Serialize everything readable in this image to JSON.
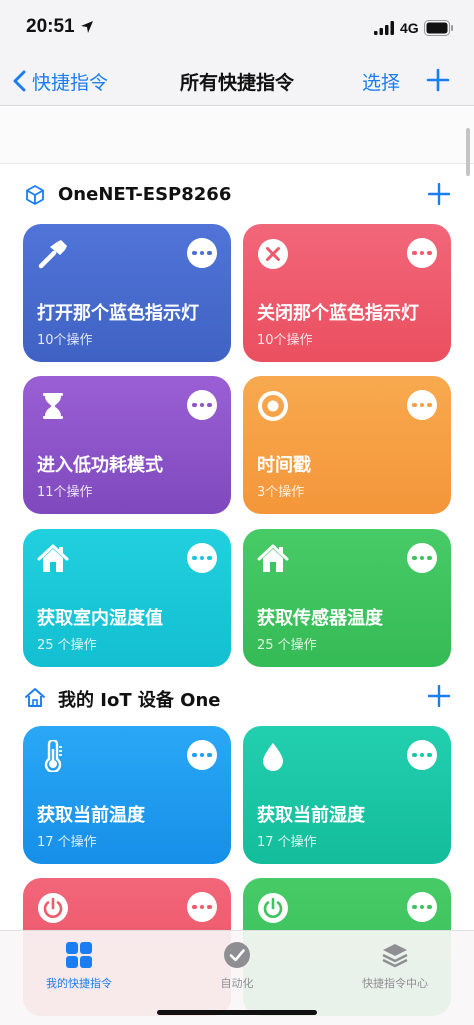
{
  "status_bar": {
    "time": "20:51",
    "network": "4G"
  },
  "nav": {
    "back_label": "快捷指令",
    "title": "所有快捷指令",
    "select_label": "选择"
  },
  "colors": {
    "accent": "#1a7df2"
  },
  "sections": [
    {
      "title": "OneNET-ESP8266",
      "icon": "cube-icon",
      "cards": [
        {
          "title": "打开那个蓝色指示灯",
          "count": "10个操作",
          "icon": "hammer-icon",
          "color": "#4a6fd0"
        },
        {
          "title": "关闭那个蓝色指示灯",
          "count": "10个操作",
          "icon": "close-circle-icon",
          "color": "#ef5b6b"
        },
        {
          "title": "进入低功耗模式",
          "count": "11个操作",
          "icon": "hourglass-icon",
          "color": "#8c55c8"
        },
        {
          "title": "时间戳",
          "count": "3个操作",
          "icon": "target-icon",
          "color": "#f6a043"
        },
        {
          "title": "获取室内湿度值",
          "count": "25 个操作",
          "icon": "home-icon",
          "color": "#19c8d8"
        },
        {
          "title": "获取传感器温度",
          "count": "25 个操作",
          "icon": "home-icon",
          "color": "#3ec45e"
        }
      ]
    },
    {
      "title": "我的 IoT 设备 One",
      "icon": "house-outline-icon",
      "cards": [
        {
          "title": "获取当前温度",
          "count": "17 个操作",
          "icon": "thermometer-icon",
          "color": "#1f9ff3"
        },
        {
          "title": "获取当前湿度",
          "count": "17 个操作",
          "icon": "droplet-icon",
          "color": "#19c7a6"
        },
        {
          "title": "",
          "count": "",
          "icon": "power-icon",
          "color": "#ef5b6b"
        },
        {
          "title": "",
          "count": "",
          "icon": "power-icon",
          "color": "#3ec45e"
        }
      ]
    }
  ],
  "tabs": [
    {
      "label": "我的快捷指令",
      "icon": "grid-icon",
      "active": true
    },
    {
      "label": "自动化",
      "icon": "clock-check-icon",
      "active": false
    },
    {
      "label": "快捷指令中心",
      "icon": "layers-icon",
      "active": false
    }
  ]
}
